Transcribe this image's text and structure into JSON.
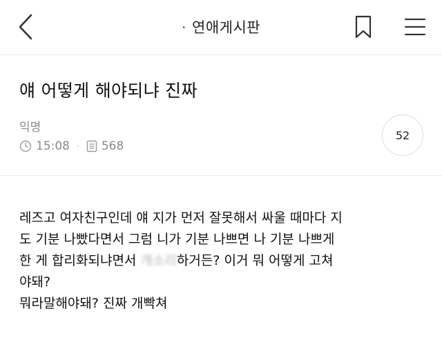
{
  "header": {
    "title_prefix": "·",
    "title": "연애게시판",
    "back_icon": "chevron-left-icon",
    "bookmark_icon": "bookmark-icon",
    "menu_icon": "hamburger-menu-icon"
  },
  "post": {
    "title": "얘 어떻게 해야되냐 진짜",
    "author": "익명",
    "time": "15:08",
    "views": "568",
    "separator": "·",
    "comment_count": "52",
    "body": {
      "line1": "레즈고 여자친구인데 얘 지가 먼저 잘못해서 싸울 때마다 지",
      "line2": "도 기분 나빴다면서 그럼 니가 기분 나쁘면 나 기분 나쁘게",
      "line3_before": "한 게 합리화되냐면서 ",
      "line3_blurred": "개소리",
      "line3_after": "하거든? 이거 뭐 어떻게 고쳐",
      "line4": "야돼?",
      "line5": "뭐라말해야돼? 진짜 개빡쳐"
    }
  },
  "colors": {
    "text": "#111111",
    "muted": "#8a8a8a",
    "divider": "#ececec",
    "circle_border": "#dedede"
  }
}
